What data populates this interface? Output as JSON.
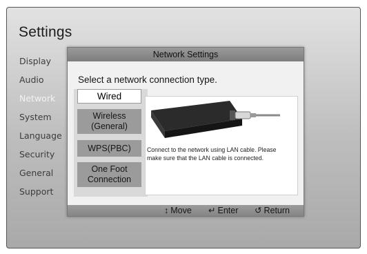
{
  "screen": {
    "title": "Settings"
  },
  "sidebar": {
    "items": [
      {
        "label": "Display"
      },
      {
        "label": "Audio"
      },
      {
        "label": "Network"
      },
      {
        "label": "System"
      },
      {
        "label": "Language"
      },
      {
        "label": "Security"
      },
      {
        "label": "General"
      },
      {
        "label": "Support"
      }
    ],
    "active_index": 2
  },
  "dialog": {
    "title": "Network Settings",
    "prompt": "Select a network connection type.",
    "options": [
      {
        "label": "Wired",
        "selected": true
      },
      {
        "label": "Wireless\n(General)",
        "selected": false
      },
      {
        "label": "WPS(PBC)",
        "selected": false
      },
      {
        "label": "One Foot\nConnection",
        "selected": false
      }
    ],
    "description": "Connect to the network using LAN cable. Please make sure that the LAN cable is connected.",
    "illustration": "lan-cable-device-icon"
  },
  "footer": {
    "move": {
      "icon": "up-down-arrow-icon",
      "label": "Move"
    },
    "enter": {
      "icon": "enter-icon",
      "label": "Enter"
    },
    "return": {
      "icon": "return-icon",
      "label": "Return"
    }
  },
  "colors": {
    "background": "#c4c4c4",
    "header_bar": "#8a8a8a",
    "option_bg": "#9b9b9b",
    "selected_bg": "#ffffff",
    "active_menu_text": "#f2f2f2"
  }
}
